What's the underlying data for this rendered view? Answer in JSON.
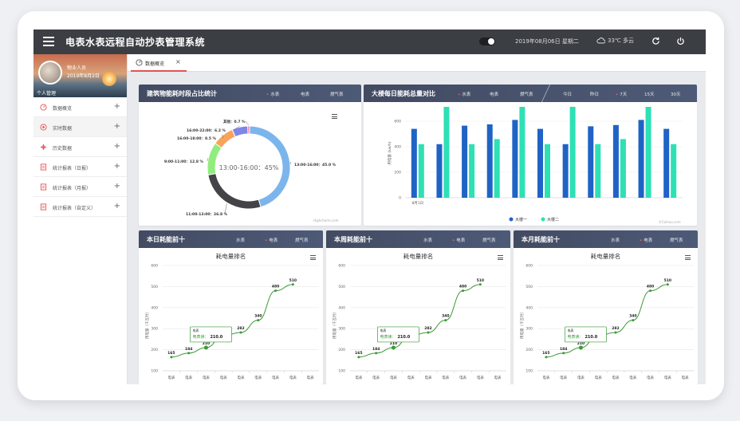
{
  "app": {
    "title": "电表水表远程自动抄表管理系统",
    "datetime": "2019年08月06日  星期二",
    "weather": "33℃  多云",
    "icons": [
      "menu-icon",
      "toggle-switch",
      "cloud-icon",
      "refresh-icon",
      "power-icon"
    ]
  },
  "sidebar": {
    "user_name": "物业人员",
    "user_date": "2019年8月2日",
    "profile_label": "个人管理",
    "items": [
      {
        "label": "数据概览",
        "icon": "dashboard-icon"
      },
      {
        "label": "实时数据",
        "icon": "gauge-icon"
      },
      {
        "label": "历史数据",
        "icon": "history-icon"
      },
      {
        "label": "统计报表（日报）",
        "icon": "report-icon"
      },
      {
        "label": "统计报表（月报）",
        "icon": "report-icon"
      },
      {
        "label": "统计报表（自定义）",
        "icon": "report-icon"
      }
    ]
  },
  "tabs": [
    {
      "label": "数据概览",
      "close": "×"
    }
  ],
  "panels": {
    "pie": {
      "title": "建筑物能耗时段占比统计",
      "options": [
        "水表",
        "电表",
        "燃气表"
      ],
      "selected": 0,
      "center_label": "13:00-16:00：45%",
      "credit": "Highcharts.com"
    },
    "bar": {
      "title": "大楼每日能耗总量对比",
      "options": [
        "水表",
        "电表",
        "燃气表"
      ],
      "selected": 0,
      "ranges": [
        "今日",
        "昨日",
        "7天",
        "15天",
        "30天"
      ],
      "range_selected": 2,
      "ylabel": "用电量 (kw/h)",
      "x_first": "8月1日",
      "legend": [
        "大楼一",
        "大楼二"
      ],
      "credit": "©Caihuo.com"
    },
    "rank": [
      {
        "title": "本日耗能前十",
        "options": [
          "水表",
          "电表",
          "燃气表"
        ],
        "selected": 1
      },
      {
        "title": "本周耗能前十",
        "options": [
          "水表",
          "电表",
          "燃气表"
        ],
        "selected": 1
      },
      {
        "title": "本月耗能前十",
        "options": [
          "水表",
          "电表",
          "燃气表"
        ],
        "selected": 1
      }
    ],
    "line_chart_title": "耗电量排名",
    "line_ylabel": "用电量（千瓦时）",
    "tooltip_name": "电表",
    "tooltip_value_label": "电表读：",
    "tooltip_value": "210.0"
  },
  "chart_data": [
    {
      "type": "pie",
      "title": "",
      "slices": [
        {
          "label": "13:00-16:00",
          "value": 45.0,
          "display": "13:00-16:00：45.0 %",
          "color": "#7cb5ec"
        },
        {
          "label": "11:00-13:00",
          "value": 26.8,
          "display": "11:00-13:00：26.8 %",
          "color": "#434348"
        },
        {
          "label": "9:00-11:00",
          "value": 12.8,
          "display": "9:00-11:00：12.8 %",
          "color": "#90ed7d"
        },
        {
          "label": "16:00-18:00",
          "value": 8.5,
          "display": "16:00-18:00：8.5 %",
          "color": "#f7a35c"
        },
        {
          "label": "16:00-22:00",
          "value": 6.2,
          "display": "16:00-22:00：6.2 %",
          "color": "#8085e9"
        },
        {
          "label": "其他",
          "value": 0.7,
          "display": "其他：0.7 %",
          "color": "#f15c80"
        }
      ]
    },
    {
      "type": "bar",
      "title": "",
      "xlabel": "",
      "ylabel": "用电量 (kw/h)",
      "ylim": [
        0,
        700
      ],
      "yticks": [
        0,
        200,
        400,
        600
      ],
      "categories": [
        "8月1日",
        "",
        "",
        "",
        "",
        "",
        "",
        "",
        "",
        "",
        ""
      ],
      "series": [
        {
          "name": "大楼一",
          "color": "#1f63c6",
          "values": [
            540,
            420,
            565,
            575,
            610,
            540,
            420,
            560,
            570,
            610,
            540
          ]
        },
        {
          "name": "大楼二",
          "color": "#2ee0b5",
          "values": [
            420,
            760,
            420,
            460,
            740,
            420,
            750,
            420,
            460,
            740,
            420
          ]
        }
      ]
    },
    {
      "type": "line",
      "title": "耗电量排名",
      "ylabel": "用电量（千瓦时）",
      "ylim": [
        100,
        600
      ],
      "yticks": [
        100,
        200,
        300,
        400,
        500,
        600
      ],
      "categories": [
        "电表",
        "电表",
        "电表",
        "电表",
        "电表",
        "电表",
        "电表",
        "电表",
        "电表"
      ],
      "series": [
        {
          "name": "电表",
          "color": "#3a9a36",
          "values": [
            165,
            184,
            210,
            267,
            282,
            340,
            480,
            510
          ]
        }
      ]
    }
  ]
}
